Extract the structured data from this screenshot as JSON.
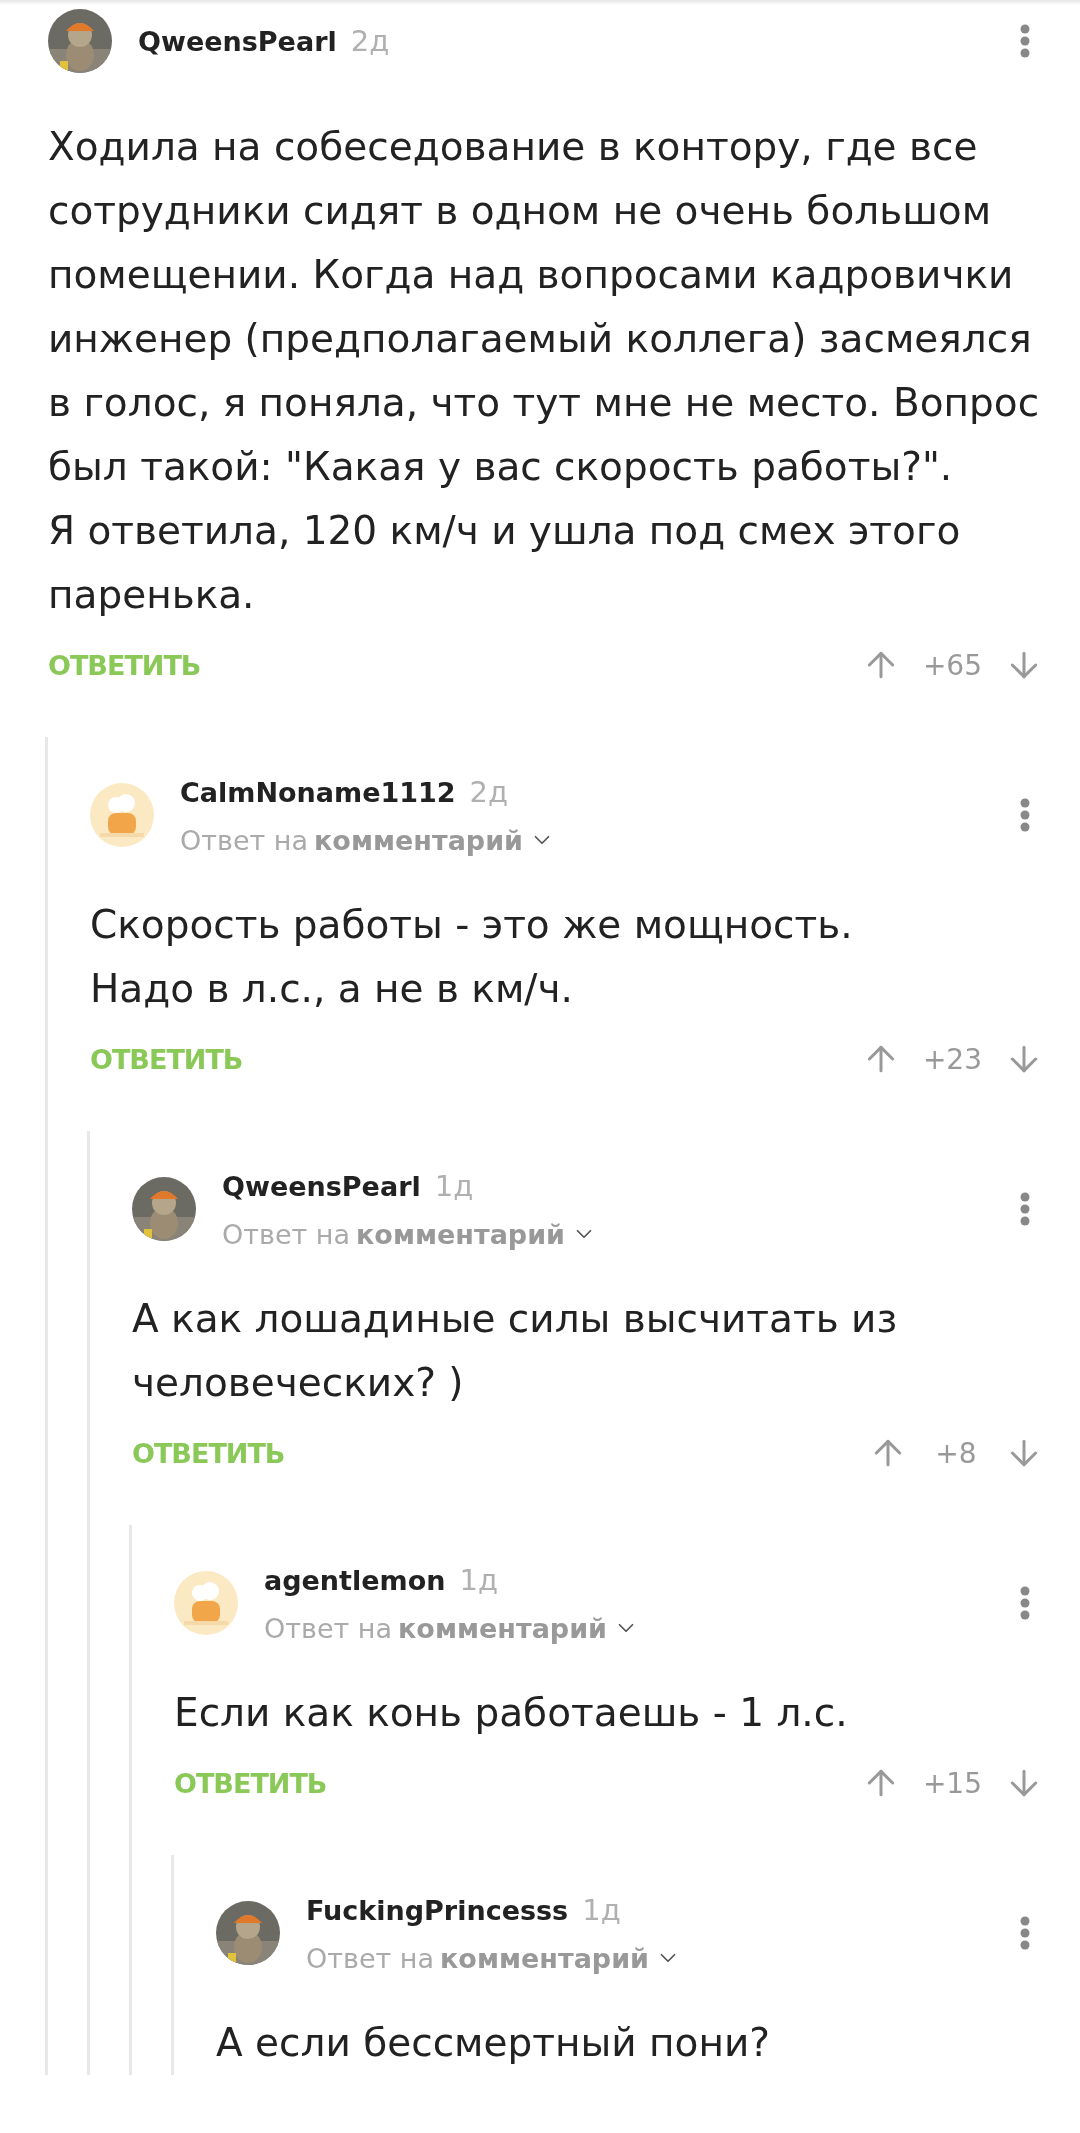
{
  "comment": {
    "avatar": {
      "kind": "picture"
    },
    "author": "QweensPearl",
    "time": "2д",
    "paragraphs": [
      "Ходила на собеседование в контору, где все сотрудники сидят в одном не очень большом помещении. Когда над вопросами кадровички инженер (предполагаемый коллега) засмеялся в голос, я поняла, что тут мне не место. Вопрос был такой: \"Какая у вас скорость работы?\".",
      "Я ответила, 120 км/ч и ушла под смех этого паренька."
    ],
    "reply": "ОТВЕТИТЬ",
    "score": "+65",
    "children": [
      {
        "avatar": {
          "kind": "default"
        },
        "author": "CalmNoname1112",
        "time": "2д",
        "reply_to": {
          "prefix": "Ответ на",
          "link": "комментарий"
        },
        "paragraphs": [
          "Скорость работы - это же мощность.",
          "Надо в л.с., а не в км/ч."
        ],
        "reply": "ОТВЕТИТЬ",
        "score": "+23",
        "children": [
          {
            "avatar": {
              "kind": "picture"
            },
            "author": "QweensPearl",
            "time": "1д",
            "reply_to": {
              "prefix": "Ответ на",
              "link": "комментарий"
            },
            "paragraphs": [
              "А как лошадиные силы высчитать из человеческих? )"
            ],
            "reply": "ОТВЕТИТЬ",
            "score": "+8",
            "children": [
              {
                "avatar": {
                  "kind": "default"
                },
                "author": "agentlemon",
                "time": "1д",
                "reply_to": {
                  "prefix": "Ответ на",
                  "link": "комментарий"
                },
                "paragraphs": [
                  "Если как конь работаешь - 1 л.с."
                ],
                "reply": "ОТВЕТИТЬ",
                "score": "+15",
                "children": [
                  {
                    "avatar": {
                      "kind": "picture"
                    },
                    "author": "FuckingPrincesss",
                    "time": "1д",
                    "reply_to": {
                      "prefix": "Ответ на",
                      "link": "комментарий"
                    },
                    "paragraphs": [
                      "А если бессмертный пони?"
                    ]
                  }
                ]
              }
            ]
          }
        ]
      }
    ]
  }
}
